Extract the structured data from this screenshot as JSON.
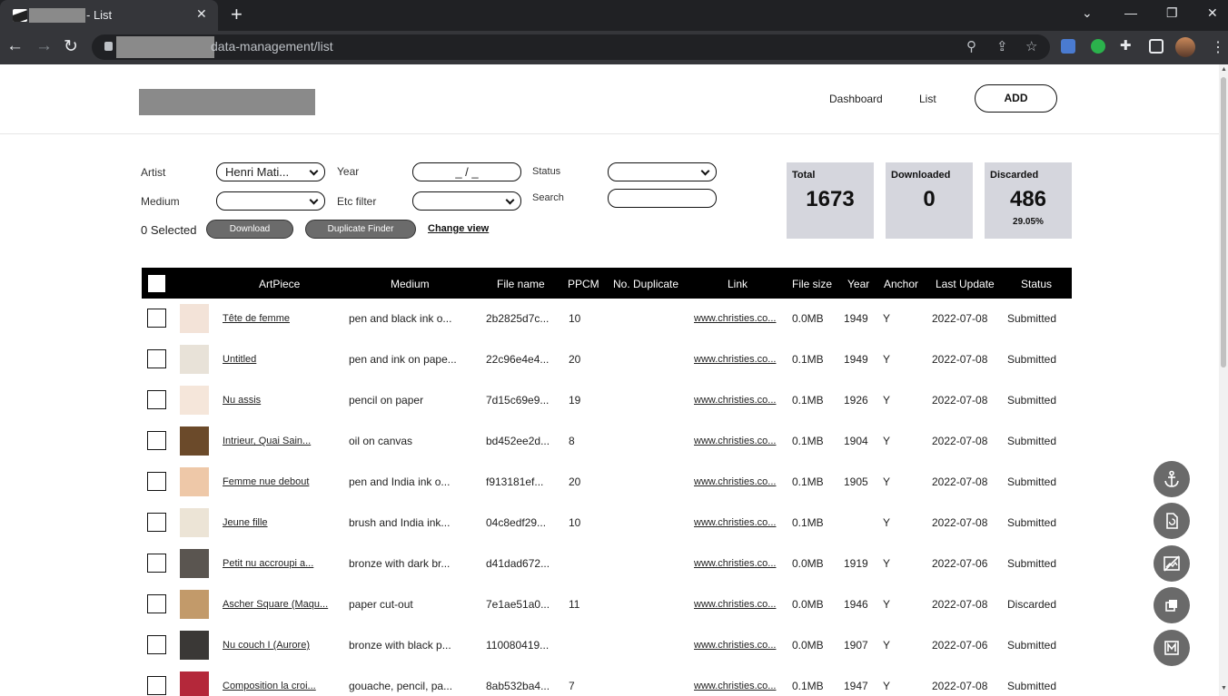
{
  "browser": {
    "tab_title": "- List",
    "url_path": "data-management/list"
  },
  "header": {
    "nav": [
      "Dashboard",
      "List"
    ],
    "add_label": "ADD"
  },
  "filters": {
    "artist_label": "Artist",
    "artist_value": "Henri Mati...",
    "year_label": "Year",
    "year_value": "_ / _",
    "status_label": "Status",
    "status_value": "",
    "medium_label": "Medium",
    "medium_value": "",
    "etc_label": "Etc filter",
    "etc_value": "",
    "search_label": "Search",
    "search_value": ""
  },
  "actions": {
    "selected_text": "0 Selected",
    "download_label": "Download",
    "duplicate_label": "Duplicate Finder",
    "change_view_label": "Change view"
  },
  "stats": {
    "total_label": "Total",
    "total_value": "1673",
    "downloaded_label": "Downloaded",
    "downloaded_value": "0",
    "discarded_label": "Discarded",
    "discarded_value": "486",
    "discarded_pct": "29.05%"
  },
  "table": {
    "headers": [
      "ArtPiece",
      "Medium",
      "File name",
      "PPCM",
      "No. Duplicate",
      "Link",
      "File size",
      "Year",
      "Anchor",
      "Last Update",
      "Status"
    ],
    "rows": [
      {
        "art": "Tête de femme",
        "medium": "pen and black ink o...",
        "file": "2b2825d7c...",
        "ppcm": "10",
        "link": "www.christies.co...",
        "size": "0.0MB",
        "year": "1949",
        "anchor": "Y",
        "update": "2022-07-08",
        "status": "Submitted",
        "thumb": "#f3e3d8"
      },
      {
        "art": "Untitled",
        "medium": "pen and ink on pape...",
        "file": "22c96e4e4...",
        "ppcm": "20",
        "link": "www.christies.co...",
        "size": "0.1MB",
        "year": "1949",
        "anchor": "Y",
        "update": "2022-07-08",
        "status": "Submitted",
        "thumb": "#e8e2d8"
      },
      {
        "art": "Nu assis",
        "medium": "pencil on paper",
        "file": "7d15c69e9...",
        "ppcm": "19",
        "link": "www.christies.co...",
        "size": "0.1MB",
        "year": "1926",
        "anchor": "Y",
        "update": "2022-07-08",
        "status": "Submitted",
        "thumb": "#f5e6da"
      },
      {
        "art": "Intrieur, Quai Sain...",
        "medium": "oil on canvas",
        "file": "bd452ee2d...",
        "ppcm": "8",
        "link": "www.christies.co...",
        "size": "0.1MB",
        "year": "1904",
        "anchor": "Y",
        "update": "2022-07-08",
        "status": "Submitted",
        "thumb": "#6b4a2a"
      },
      {
        "art": "Femme nue debout",
        "medium": "pen and India ink o...",
        "file": "f913181ef...",
        "ppcm": "20",
        "link": "www.christies.co...",
        "size": "0.1MB",
        "year": "1905",
        "anchor": "Y",
        "update": "2022-07-08",
        "status": "Submitted",
        "thumb": "#eec8a8"
      },
      {
        "art": "Jeune fille",
        "medium": "brush and India ink...",
        "file": "04c8edf29...",
        "ppcm": "10",
        "link": "www.christies.co...",
        "size": "0.1MB",
        "year": "",
        "anchor": "Y",
        "update": "2022-07-08",
        "status": "Submitted",
        "thumb": "#ece4d6"
      },
      {
        "art": "Petit nu accroupi a...",
        "medium": "bronze with dark br...",
        "file": "d41dad672...",
        "ppcm": "",
        "link": "www.christies.co...",
        "size": "0.0MB",
        "year": "1919",
        "anchor": "Y",
        "update": "2022-07-06",
        "status": "Submitted",
        "thumb": "#5a5550"
      },
      {
        "art": "Ascher Square (Maqu...",
        "medium": "paper cut-out",
        "file": "7e1ae51a0...",
        "ppcm": "11",
        "link": "www.christies.co...",
        "size": "0.0MB",
        "year": "1946",
        "anchor": "Y",
        "update": "2022-07-08",
        "status": "Discarded",
        "thumb": "#c29a6a"
      },
      {
        "art": "Nu couch I (Aurore)",
        "medium": "bronze with black p...",
        "file": "110080419...",
        "ppcm": "",
        "link": "www.christies.co...",
        "size": "0.0MB",
        "year": "1907",
        "anchor": "Y",
        "update": "2022-07-06",
        "status": "Submitted",
        "thumb": "#3a3836"
      },
      {
        "art": "Composition la croi...",
        "medium": "gouache, pencil, pa...",
        "file": "8ab532ba4...",
        "ppcm": "7",
        "link": "www.christies.co...",
        "size": "0.1MB",
        "year": "1947",
        "anchor": "Y",
        "update": "2022-07-08",
        "status": "Submitted",
        "thumb": "#b4283a"
      }
    ]
  },
  "fab_icons": [
    "anchor-icon",
    "download-file-icon",
    "hide-image-icon",
    "copy-icon",
    "m-badge-icon"
  ]
}
